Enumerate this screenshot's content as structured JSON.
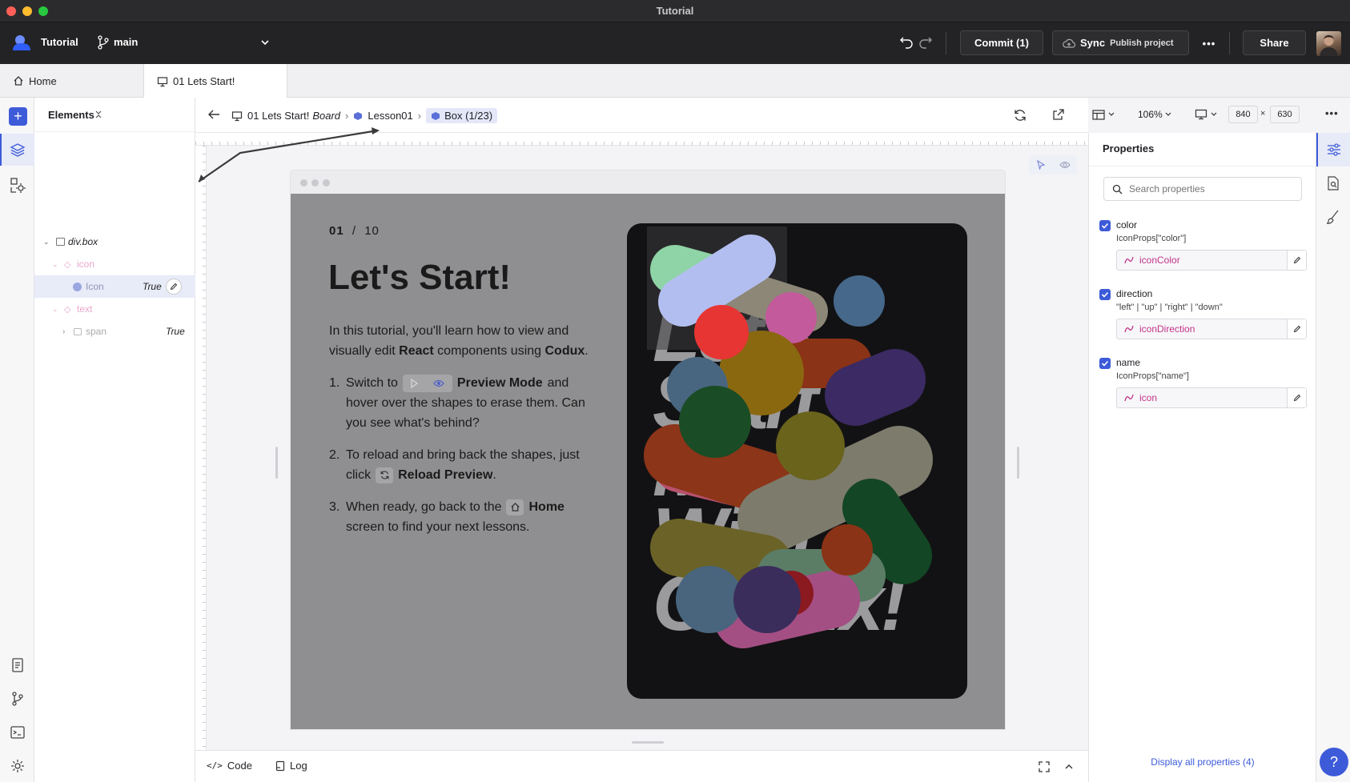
{
  "window": {
    "title": "Tutorial"
  },
  "toolbar": {
    "project": "Tutorial",
    "branch": "main",
    "commit_label": "Commit (1)",
    "sync_label": "Sync",
    "publish_label": "Publish project",
    "share_label": "Share"
  },
  "tabs": [
    {
      "label": "Home"
    },
    {
      "label": "01 Lets Start!"
    }
  ],
  "elements_panel": {
    "title": "Elements",
    "tree": [
      {
        "label": "div.box",
        "value": ""
      },
      {
        "label": "icon",
        "value": ""
      },
      {
        "label": "Icon",
        "value": "True"
      },
      {
        "label": "text",
        "value": ""
      },
      {
        "label": "span",
        "value": "True"
      }
    ]
  },
  "breadcrumb": {
    "board": "01 Lets Start!",
    "board_suffix": "Board",
    "lesson": "Lesson01",
    "box": "Box (1/23)"
  },
  "canvas_toolbar": {
    "zoom": "106%",
    "width": "840",
    "height": "630",
    "times": "×"
  },
  "lesson": {
    "counter_current": "01",
    "counter_sep": "/",
    "counter_total": "10",
    "title": "Let's Start!",
    "intro_1": "In this tutorial, you'll learn how to view and",
    "intro_2a": "visually edit ",
    "intro_react": "React",
    "intro_2b": " components using ",
    "intro_codux": "Codux",
    "intro_2c": ".",
    "steps": [
      {
        "n": "1.",
        "pre": "Switch to",
        "bold": "Preview Mode",
        "post": "and",
        "l2": "hover over the shapes to erase them. Can",
        "l3": "you see what's behind?"
      },
      {
        "n": "2.",
        "pre": "To reload and bring back the shapes, just",
        "l2pre": "click",
        "bold": "Reload Preview",
        "post": "."
      },
      {
        "n": "3.",
        "pre": "When ready, go back to the",
        "bold": "Home",
        "l2": "screen to find your next lessons."
      }
    ],
    "poster_text": [
      "Let's",
      "Start",
      "Mixing",
      "With",
      "Codux!"
    ]
  },
  "bottom_bar": {
    "code_label": "Code",
    "log_label": "Log"
  },
  "properties": {
    "title": "Properties",
    "search_placeholder": "Search properties",
    "items": [
      {
        "name": "color",
        "type": "IconProps[\"color\"]",
        "value": "iconColor"
      },
      {
        "name": "direction",
        "type": "\"left\" | \"up\" | \"right\" | \"down\"",
        "value": "iconDirection"
      },
      {
        "name": "name",
        "type": "IconProps[\"name\"]",
        "value": "icon"
      }
    ],
    "display_all": "Display all properties (4)"
  },
  "help": {
    "label": "?"
  },
  "colors": {
    "accent": "#3d5bd9",
    "toolbar_bg": "#232325",
    "preview_bg": "#8f8f91",
    "poster_bg": "#121214",
    "pink_expression": "#c2338a"
  }
}
